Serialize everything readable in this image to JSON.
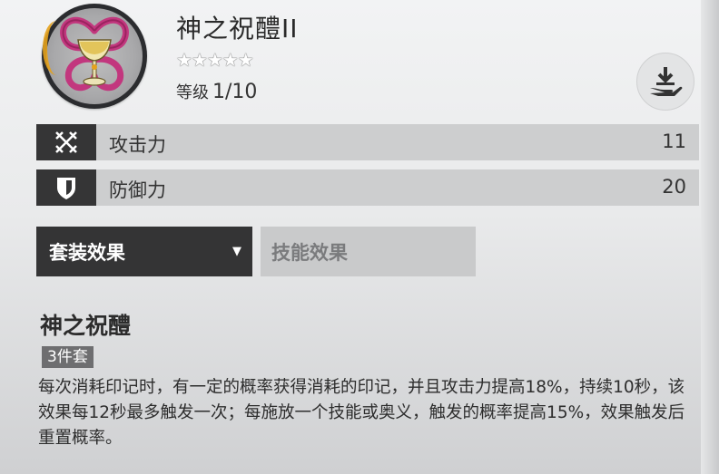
{
  "item": {
    "name": "神之祝醴II",
    "stars": "★★★★★",
    "level_label": "等级",
    "level_value": "1/10",
    "icon": "holy-chalice-emblem"
  },
  "actions": {
    "unequip_icon": "unequip-hand-download-icon"
  },
  "stats": [
    {
      "icon": "attack-crossed-swords-icon",
      "label": "攻击力",
      "value": "11"
    },
    {
      "icon": "defense-shield-icon",
      "label": "防御力",
      "value": "20"
    }
  ],
  "tabs": {
    "set_effect": "套装效果",
    "skill_effect": "技能效果",
    "dropdown_icon": "triangle-down-icon"
  },
  "set": {
    "name": "神之祝醴",
    "piece_badge": "3件套",
    "description": "每次消耗印记时，有一定的概率获得消耗的印记，并且攻击力提高18%，持续10秒，该效果每12秒最多触发一次；每施放一个技能或奥义，触发的概率提高15%，效果触发后重置概率。"
  },
  "colors": {
    "dark_panel": "#343435",
    "stat_bar": "#cdcecf",
    "emblem_pink": "#c2377e",
    "emblem_gold": "#e5a21c"
  }
}
